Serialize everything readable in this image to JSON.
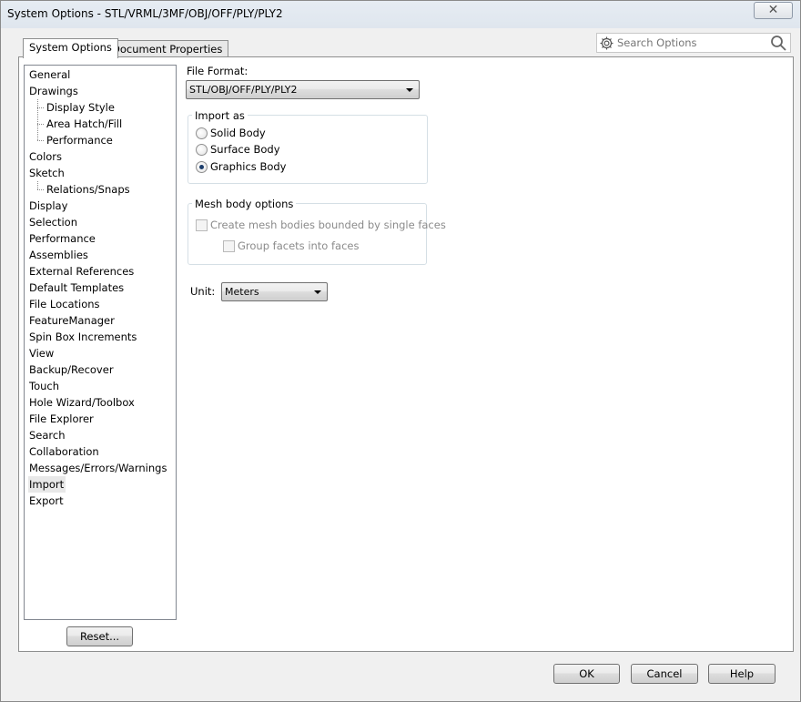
{
  "window": {
    "title": "System Options - STL/VRML/3MF/OBJ/OFF/PLY/PLY2",
    "close_glyph": "✕"
  },
  "tabs": [
    {
      "label": "System Options",
      "active": true
    },
    {
      "label": "Document Properties",
      "active": false
    }
  ],
  "search": {
    "placeholder": "Search Options",
    "icon_left": "gear-icon",
    "icon_right": "search-icon"
  },
  "tree": {
    "items": [
      {
        "label": "General",
        "level": 0
      },
      {
        "label": "Drawings",
        "level": 0
      },
      {
        "label": "Display Style",
        "level": 1
      },
      {
        "label": "Area Hatch/Fill",
        "level": 1
      },
      {
        "label": "Performance",
        "level": 1
      },
      {
        "label": "Colors",
        "level": 0
      },
      {
        "label": "Sketch",
        "level": 0
      },
      {
        "label": "Relations/Snaps",
        "level": 1
      },
      {
        "label": "Display",
        "level": 0
      },
      {
        "label": "Selection",
        "level": 0
      },
      {
        "label": "Performance",
        "level": 0
      },
      {
        "label": "Assemblies",
        "level": 0
      },
      {
        "label": "External References",
        "level": 0
      },
      {
        "label": "Default Templates",
        "level": 0
      },
      {
        "label": "File Locations",
        "level": 0
      },
      {
        "label": "FeatureManager",
        "level": 0
      },
      {
        "label": "Spin Box Increments",
        "level": 0
      },
      {
        "label": "View",
        "level": 0
      },
      {
        "label": "Backup/Recover",
        "level": 0
      },
      {
        "label": "Touch",
        "level": 0
      },
      {
        "label": "Hole Wizard/Toolbox",
        "level": 0
      },
      {
        "label": "File Explorer",
        "level": 0
      },
      {
        "label": "Search",
        "level": 0
      },
      {
        "label": "Collaboration",
        "level": 0
      },
      {
        "label": "Messages/Errors/Warnings",
        "level": 0
      },
      {
        "label": "Import",
        "level": 0,
        "selected": true
      },
      {
        "label": "Export",
        "level": 0
      }
    ],
    "reset_label": "Reset..."
  },
  "main": {
    "file_format_label": "File Format:",
    "file_format_value": "STL/OBJ/OFF/PLY/PLY2",
    "import_as": {
      "title": "Import as",
      "options": [
        {
          "label": "Solid Body",
          "checked": false
        },
        {
          "label": "Surface Body",
          "checked": false
        },
        {
          "label": "Graphics Body",
          "checked": true
        }
      ]
    },
    "mesh": {
      "title": "Mesh body options",
      "create_label": "Create mesh bodies bounded by single faces",
      "group_label": "Group facets into faces"
    },
    "unit_label": "Unit:",
    "unit_value": "Meters"
  },
  "footer": {
    "ok": "OK",
    "cancel": "Cancel",
    "help": "Help"
  }
}
